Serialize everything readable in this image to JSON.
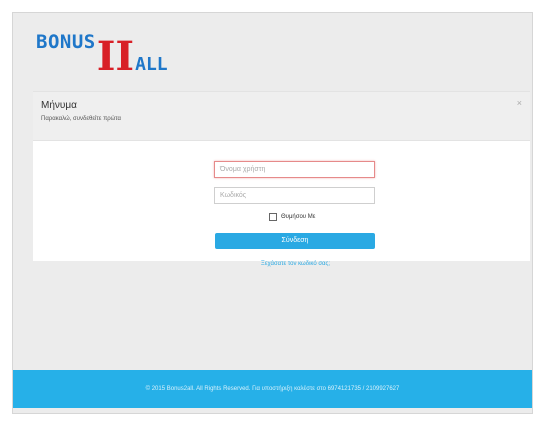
{
  "logo": {
    "part1": "BONUS",
    "part2": "II",
    "part3": "ALL"
  },
  "message": {
    "title": "Μήνυμα",
    "body": "Παρακαλώ, συνδεθείτε πρώτα",
    "close": "×"
  },
  "login": {
    "username_placeholder": "Όνομα χρήστη",
    "password_placeholder": "Κωδικός",
    "remember_label": "Θυμήσου Με",
    "submit_label": "Σύνδεση",
    "forgot_label": "Ξεχάσατε τον κωδικό σας;"
  },
  "footer": {
    "text": "© 2015 Bonus2all. All Rights Reserved. Για υποστήριξη καλέστε στο 6974121735 / 2109927627"
  },
  "colors": {
    "accent": "#26b0e8",
    "brand_blue": "#1f77c9",
    "brand_red": "#d81f26"
  }
}
